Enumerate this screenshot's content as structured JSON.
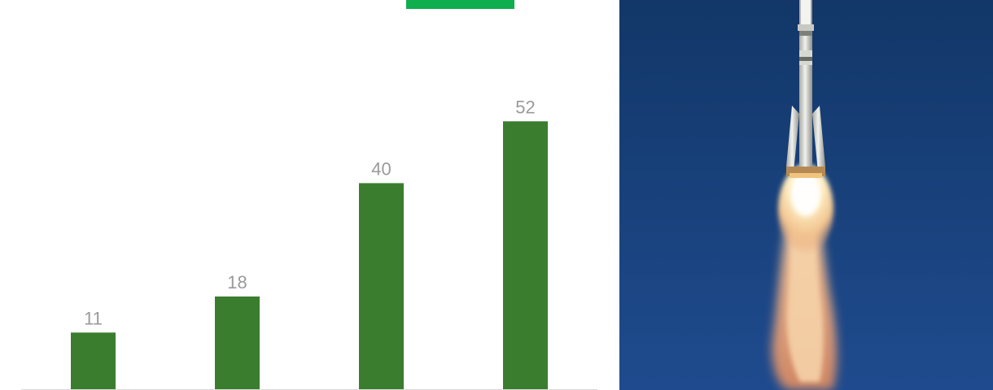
{
  "chart_data": {
    "type": "bar",
    "categories": [
      "",
      "",
      "",
      ""
    ],
    "values": [
      11,
      18,
      40,
      52
    ],
    "ylim": [
      0,
      57.5
    ],
    "grid": false,
    "legend": "top",
    "colors": {
      "bar": "#3b7d2f",
      "legend_swatch": "#0fae4f",
      "value_label": "#9a9a9a",
      "axis": "#d9d9d9"
    }
  },
  "photo": {
    "icon": "rocket-launch-photo",
    "colors": {
      "sky_top": "#123768",
      "sky_bottom": "#1f4b8e",
      "rocket_body": "#e8e8e4",
      "rocket_shadow": "#a9a9a3",
      "flame": "#fff1c9",
      "exhaust": "#e79a6d"
    }
  }
}
